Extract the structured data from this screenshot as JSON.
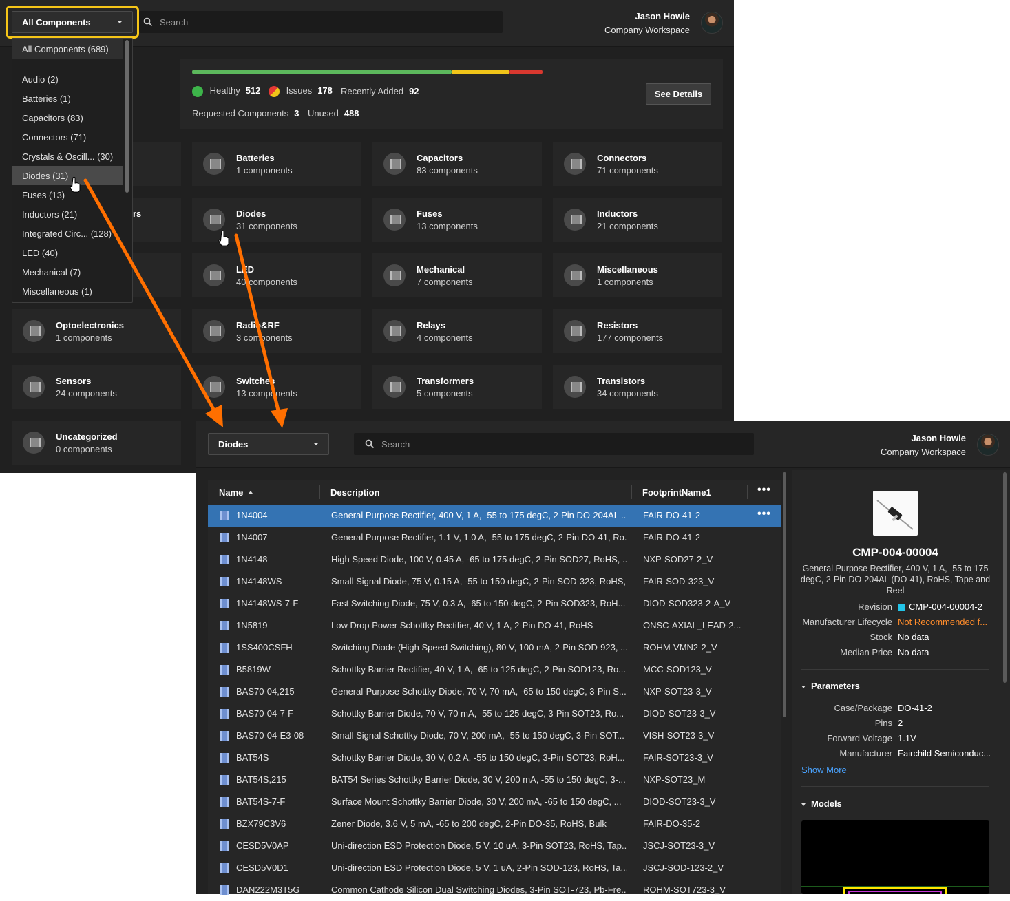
{
  "top": {
    "dropdown_label": "All Components",
    "search_placeholder": "Search",
    "user_name": "Jason Howie",
    "workspace": "Company Workspace",
    "stats": {
      "healthy_label": "Healthy",
      "healthy_value": "512",
      "issues_label": "Issues",
      "issues_value": "178",
      "recent_label": "Recently Added",
      "recent_value": "92",
      "requested_label": "Requested Components",
      "requested_value": "3",
      "unused_label": "Unused",
      "unused_value": "488",
      "see_details": "See Details",
      "bar_fractions": {
        "healthy": 0.74,
        "issues": 0.165,
        "other": 0.095
      },
      "colors": {
        "healthy": "#5cb85c",
        "issues": "#f0c419",
        "other": "#d9382f"
      }
    },
    "menu_items": [
      "All Components (689)",
      "Audio (2)",
      "Batteries (1)",
      "Capacitors (83)",
      "Connectors (71)",
      "Crystals & Oscill... (30)",
      "Diodes (31)",
      "Fuses (13)",
      "Inductors (21)",
      "Integrated Circ... (128)",
      "LED (40)",
      "Mechanical (7)",
      "Miscellaneous (1)"
    ],
    "partial_tile_text": "rs",
    "tiles": [
      {
        "name": "Batteries",
        "count": "1 components"
      },
      {
        "name": "Capacitors",
        "count": "83 components"
      },
      {
        "name": "Connectors",
        "count": "71 components"
      },
      {
        "name": "Diodes",
        "count": "31 components"
      },
      {
        "name": "Fuses",
        "count": "13 components"
      },
      {
        "name": "Inductors",
        "count": "21 components"
      },
      {
        "name": "LED",
        "count": "40 components"
      },
      {
        "name": "Mechanical",
        "count": "7 components"
      },
      {
        "name": "Miscellaneous",
        "count": "1 components"
      },
      {
        "name": "Optoelectronics",
        "count": "1 components"
      },
      {
        "name": "Radio&RF",
        "count": "3 components"
      },
      {
        "name": "Relays",
        "count": "4 components"
      },
      {
        "name": "Resistors",
        "count": "177 components"
      },
      {
        "name": "Sensors",
        "count": "24 components"
      },
      {
        "name": "Switches",
        "count": "13 components"
      },
      {
        "name": "Transformers",
        "count": "5 components"
      },
      {
        "name": "Transistors",
        "count": "34 components"
      },
      {
        "name": "Uncategorized",
        "count": "0 components"
      }
    ]
  },
  "bottom": {
    "dropdown_label": "Diodes",
    "search_placeholder": "Search",
    "user_name": "Jason Howie",
    "workspace": "Company Workspace",
    "columns": {
      "name": "Name",
      "description": "Description",
      "footprint": "FootprintName1"
    },
    "rows": [
      {
        "name": "1N4004",
        "desc": "General Purpose Rectifier, 400 V, 1 A, -55 to 175 degC, 2-Pin DO-204AL ...",
        "fp": "FAIR-DO-41-2"
      },
      {
        "name": "1N4007",
        "desc": "General Purpose Rectifier, 1.1 V, 1.0 A, -55 to 175 degC, 2-Pin DO-41, Ro...",
        "fp": "FAIR-DO-41-2"
      },
      {
        "name": "1N4148",
        "desc": "High Speed Diode, 100 V, 0.45 A, -65 to 175 degC, 2-Pin SOD27, RoHS, ...",
        "fp": "NXP-SOD27-2_V"
      },
      {
        "name": "1N4148WS",
        "desc": "Small Signal Diode, 75 V, 0.15 A, -55 to 150 degC, 2-Pin SOD-323, RoHS,...",
        "fp": "FAIR-SOD-323_V"
      },
      {
        "name": "1N4148WS-7-F",
        "desc": "Fast Switching Diode, 75 V, 0.3 A, -65 to 150 degC, 2-Pin SOD323, RoH...",
        "fp": "DIOD-SOD323-2-A_V"
      },
      {
        "name": "1N5819",
        "desc": "Low Drop Power Schottky Rectifier, 40 V, 1 A, 2-Pin DO-41, RoHS",
        "fp": "ONSC-AXIAL_LEAD-2..."
      },
      {
        "name": "1SS400CSFH",
        "desc": "Switching Diode (High Speed Switching), 80 V, 100 mA, 2-Pin SOD-923, ...",
        "fp": "ROHM-VMN2-2_V"
      },
      {
        "name": "B5819W",
        "desc": "Schottky Barrier Rectifier, 40 V, 1 A, -65 to 125 degC, 2-Pin SOD123, Ro...",
        "fp": "MCC-SOD123_V"
      },
      {
        "name": "BAS70-04,215",
        "desc": "General-Purpose Schottky Diode, 70 V, 70 mA, -65 to 150 degC, 3-Pin S...",
        "fp": "NXP-SOT23-3_V"
      },
      {
        "name": "BAS70-04-7-F",
        "desc": "Schottky Barrier Diode, 70 V, 70 mA, -55 to 125 degC, 3-Pin SOT23, Ro...",
        "fp": "DIOD-SOT23-3_V"
      },
      {
        "name": "BAS70-04-E3-08",
        "desc": "Small Signal Schottky Diode, 70 V, 200 mA, -55 to 150 degC, 3-Pin SOT...",
        "fp": "VISH-SOT23-3_V"
      },
      {
        "name": "BAT54S",
        "desc": "Schottky Barrier Diode, 30 V, 0.2 A, -55 to 150 degC, 3-Pin SOT23, RoH...",
        "fp": "FAIR-SOT23-3_V"
      },
      {
        "name": "BAT54S,215",
        "desc": "BAT54 Series Schottky Barrier Diode, 30 V, 200 mA, -55 to 150 degC, 3-...",
        "fp": "NXP-SOT23_M"
      },
      {
        "name": "BAT54S-7-F",
        "desc": "Surface Mount Schottky Barrier Diode, 30 V, 200 mA, -65 to 150 degC, ...",
        "fp": "DIOD-SOT23-3_V"
      },
      {
        "name": "BZX79C3V6",
        "desc": "Zener Diode, 3.6 V, 5 mA, -65 to 200 degC, 2-Pin DO-35, RoHS, Bulk",
        "fp": "FAIR-DO-35-2"
      },
      {
        "name": "CESD5V0AP",
        "desc": "Uni-direction ESD Protection Diode, 5 V, 10 uA, 3-Pin SOT23, RoHS, Tap...",
        "fp": "JSCJ-SOT23-3_V"
      },
      {
        "name": "CESD5V0D1",
        "desc": "Uni-direction ESD Protection Diode, 5 V, 1 uA, 2-Pin SOD-123, RoHS, Ta...",
        "fp": "JSCJ-SOD-123-2_V"
      },
      {
        "name": "DAN222M3T5G",
        "desc": "Common Cathode Silicon Dual Switching Diodes, 3-Pin SOT-723, Pb-Fre...",
        "fp": "ROHM-SOT723-3_V"
      }
    ],
    "detail": {
      "part_id": "CMP-004-00004",
      "description": "General Purpose Rectifier, 400 V, 1 A, -55 to 175 degC, 2-Pin DO-204AL (DO-41), RoHS, Tape and Reel",
      "revision_label": "Revision",
      "revision_value": "CMP-004-00004-2",
      "lifecycle_label": "Manufacturer Lifecycle",
      "lifecycle_value": "Not Recommended f...",
      "stock_label": "Stock",
      "stock_value": "No data",
      "price_label": "Median Price",
      "price_value": "No data",
      "parameters_label": "Parameters",
      "case_label": "Case/Package",
      "case_value": "DO-41-2",
      "pins_label": "Pins",
      "pins_value": "2",
      "voltage_label": "Forward Voltage",
      "voltage_value": "1.1V",
      "mfr_label": "Manufacturer",
      "mfr_value": "Fairchild Semiconduc...",
      "show_more": "Show More",
      "models_label": "Models",
      "colors": {
        "revision": "#22c4e8",
        "lifecycle": "#ff8c2b",
        "show_more": "#4aa3ff"
      }
    }
  },
  "annotation_color": "#ff6f00"
}
